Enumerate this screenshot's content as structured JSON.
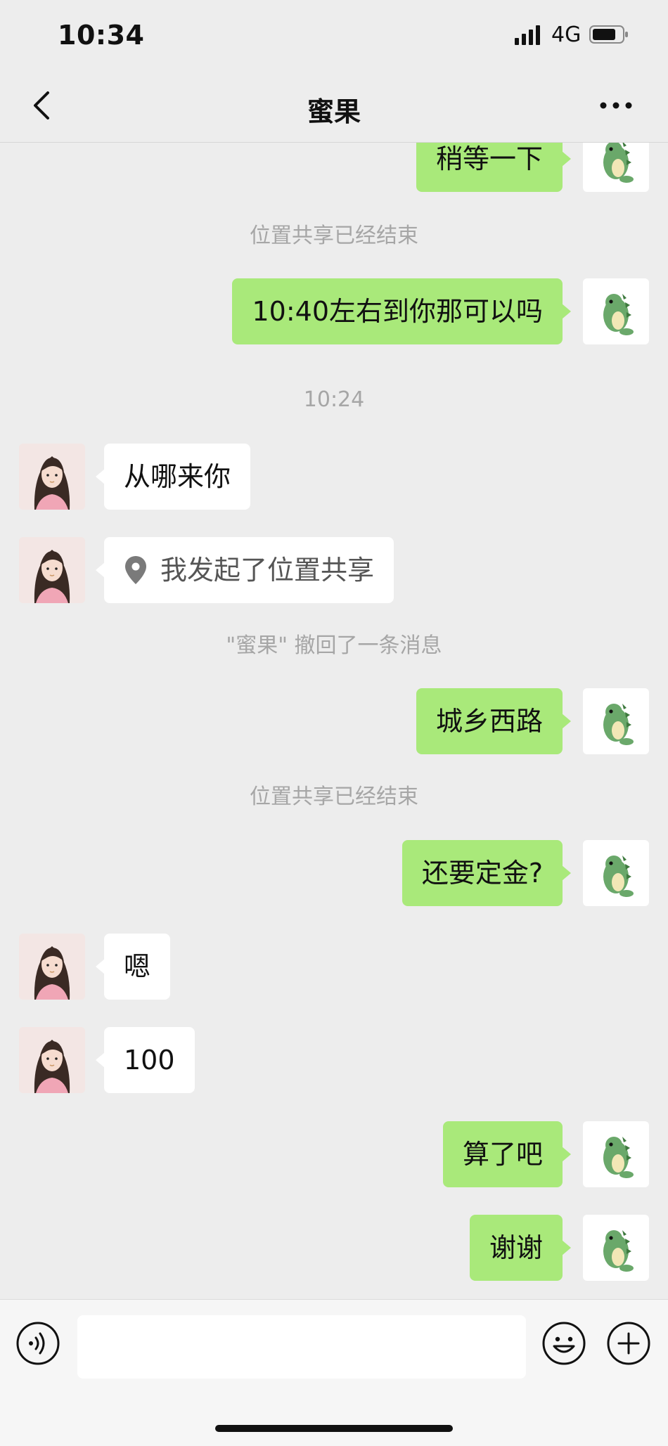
{
  "status_bar": {
    "time": "10:34",
    "network": "4G"
  },
  "nav": {
    "title": "蜜果"
  },
  "messages": {
    "m1": "稍等一下",
    "s1": "位置共享已经结束",
    "m2": "10:40左右到你那可以吗",
    "t1": "10:24",
    "h1": "从哪来你",
    "h2": "我发起了位置共享",
    "s2": "\"蜜果\" 撤回了一条消息",
    "m3": "城乡西路",
    "s3": "位置共享已经结束",
    "m4": "还要定金?",
    "h3": "嗯",
    "h4": "100",
    "m5": "算了吧",
    "m6": "谢谢"
  },
  "input": {
    "value": ""
  },
  "colors": {
    "my_bubble": "#a9e97a",
    "background": "#ededed"
  }
}
